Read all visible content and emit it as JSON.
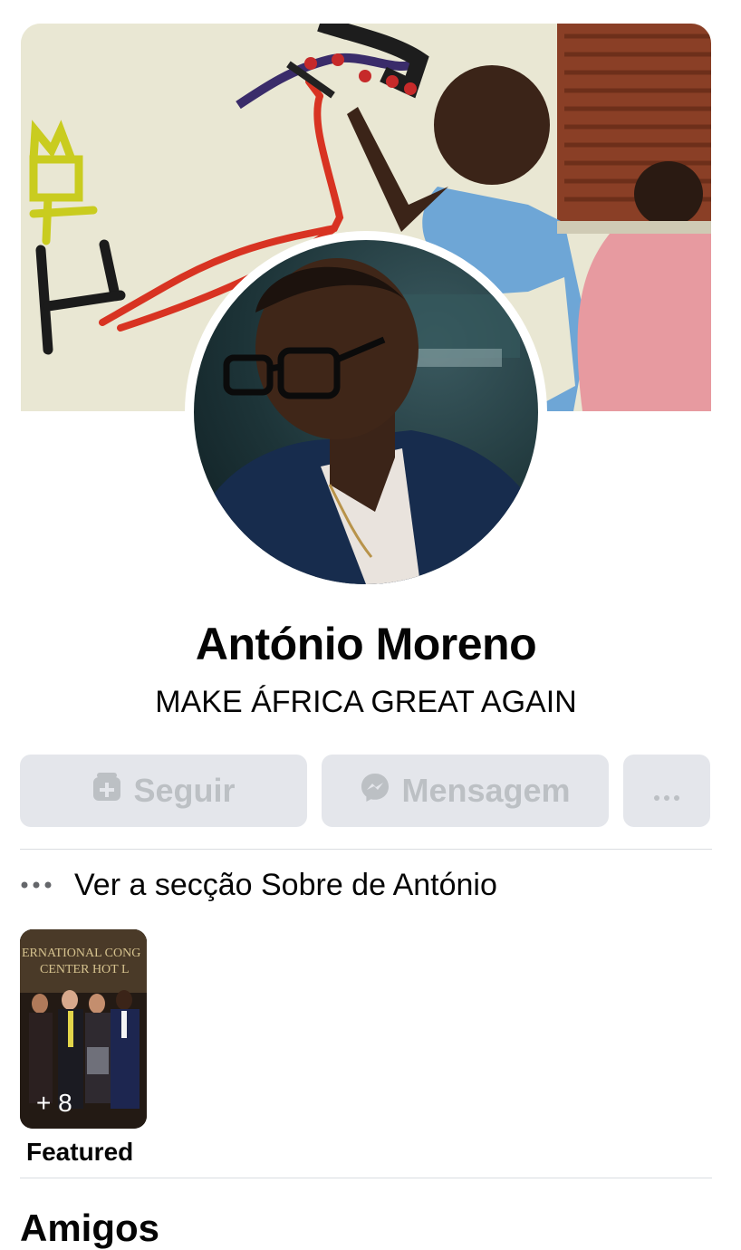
{
  "profile": {
    "name": "António Moreno",
    "bio": "MAKE ÁFRICA GREAT AGAIN"
  },
  "actions": {
    "follow_label": "Seguir",
    "message_label": "Mensagem"
  },
  "about": {
    "label": "Ver a secção Sobre de António"
  },
  "featured": {
    "overlay_count": "+ 8",
    "label": "Featured",
    "photo_sign_line1": "ERNATIONAL CONG",
    "photo_sign_line2": "CENTER HOT L"
  },
  "sections": {
    "friends_title": "Amigos"
  },
  "icons": {
    "follow": "follow-plus-icon",
    "message": "messenger-icon",
    "more": "more-dots-icon",
    "about": "about-dots-icon"
  },
  "colors": {
    "button_bg": "#e4e6eb",
    "button_text_disabled": "#bcc0c4",
    "divider": "#dadde1",
    "text_primary": "#050505"
  }
}
